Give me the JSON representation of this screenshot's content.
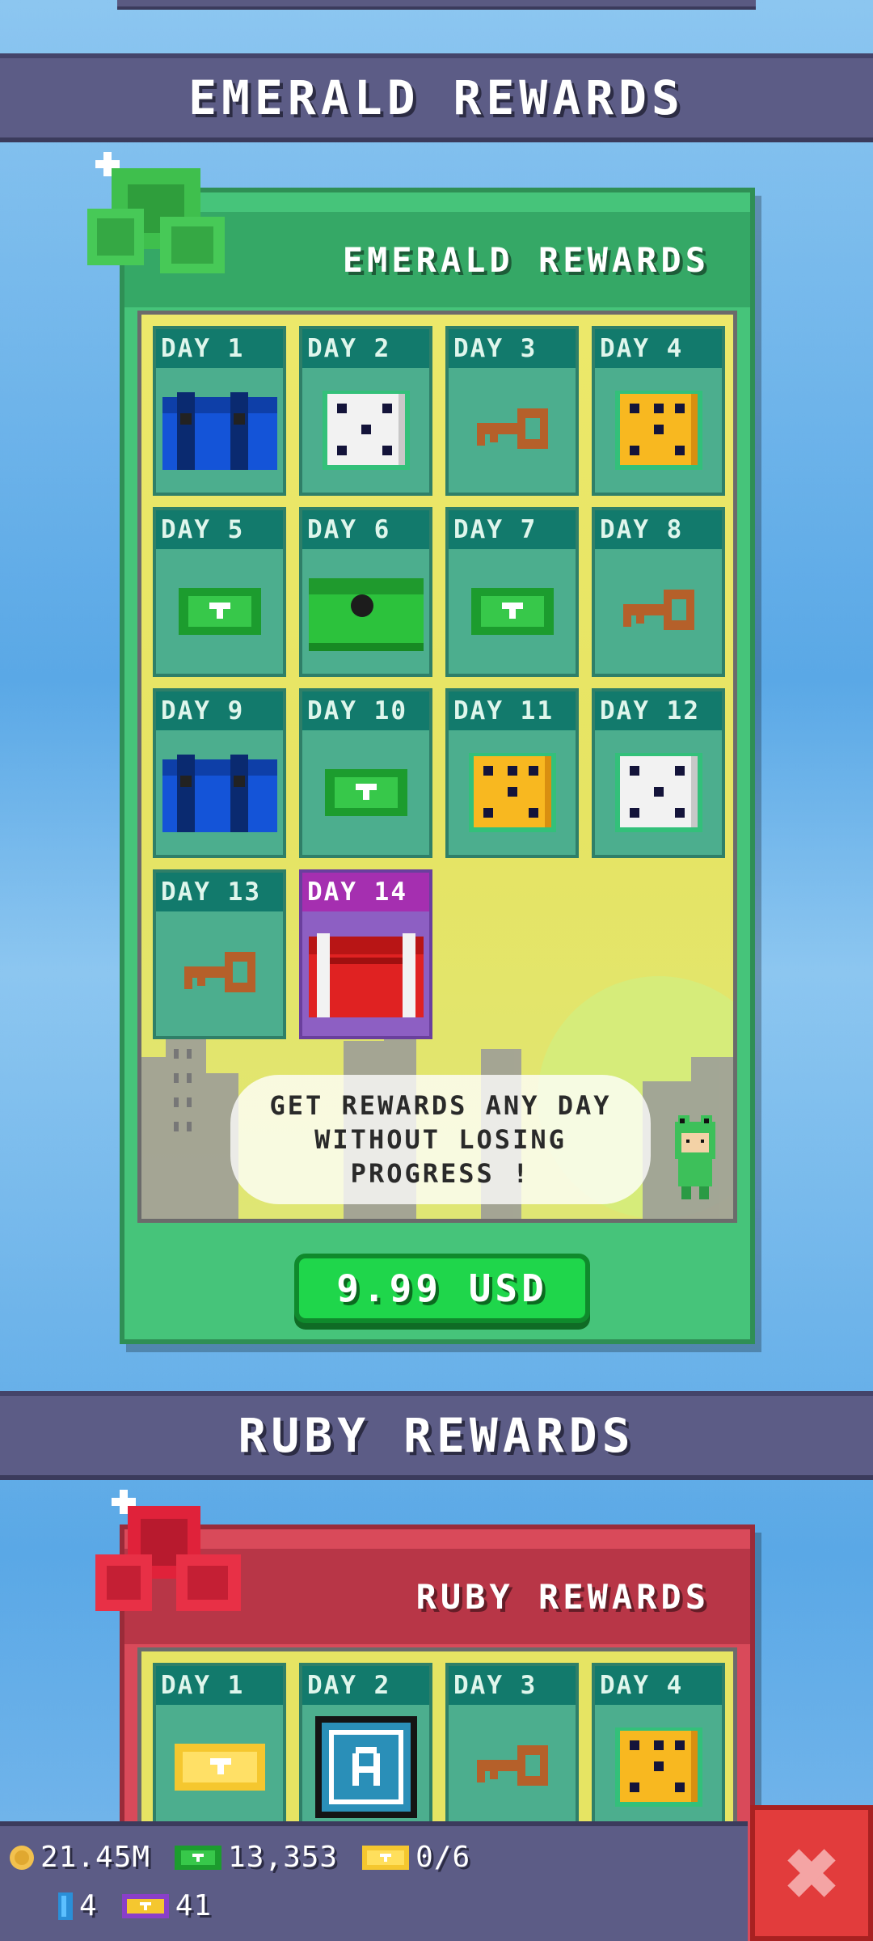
{
  "sections": {
    "emerald_header": "EMERALD REWARDS",
    "ruby_header": "RUBY REWARDS"
  },
  "emerald_panel": {
    "title": "EMERALD REWARDS",
    "message": "GET REWARDS ANY DAY WITHOUT LOSING PROGRESS !",
    "price_label": "9.99 USD",
    "days": [
      {
        "label": "DAY 1",
        "reward": "blue-chest-icon"
      },
      {
        "label": "DAY 2",
        "reward": "white-dice-icon"
      },
      {
        "label": "DAY 3",
        "reward": "key-icon"
      },
      {
        "label": "DAY 4",
        "reward": "gold-dice-icon"
      },
      {
        "label": "DAY 5",
        "reward": "cash-icon"
      },
      {
        "label": "DAY 6",
        "reward": "green-chest-icon"
      },
      {
        "label": "DAY 7",
        "reward": "cash-icon"
      },
      {
        "label": "DAY 8",
        "reward": "key-icon"
      },
      {
        "label": "DAY 9",
        "reward": "blue-chest-icon"
      },
      {
        "label": "DAY 10",
        "reward": "cash-icon"
      },
      {
        "label": "DAY 11",
        "reward": "gold-dice-icon"
      },
      {
        "label": "DAY 12",
        "reward": "white-dice-icon"
      },
      {
        "label": "DAY 13",
        "reward": "key-icon"
      },
      {
        "label": "DAY 14",
        "reward": "red-chest-icon"
      }
    ]
  },
  "ruby_panel": {
    "title": "RUBY REWARDS",
    "days": [
      {
        "label": "DAY 1",
        "reward": "gold-ticket-icon"
      },
      {
        "label": "DAY 2",
        "reward": "auto-card-icon"
      },
      {
        "label": "DAY 3",
        "reward": "key-icon"
      },
      {
        "label": "DAY 4",
        "reward": "gold-dice-icon"
      }
    ]
  },
  "hud": {
    "coins": "21.45M",
    "cash": "13,353",
    "tickets": "0/6",
    "gems": "4",
    "purple_tickets": "41"
  },
  "colors": {
    "emerald_panel": "#46c47a",
    "ruby_panel": "#d94a5a",
    "header_bar": "#5c5c86",
    "buy_button": "#1fd64b",
    "close_button": "#e23c3c"
  }
}
